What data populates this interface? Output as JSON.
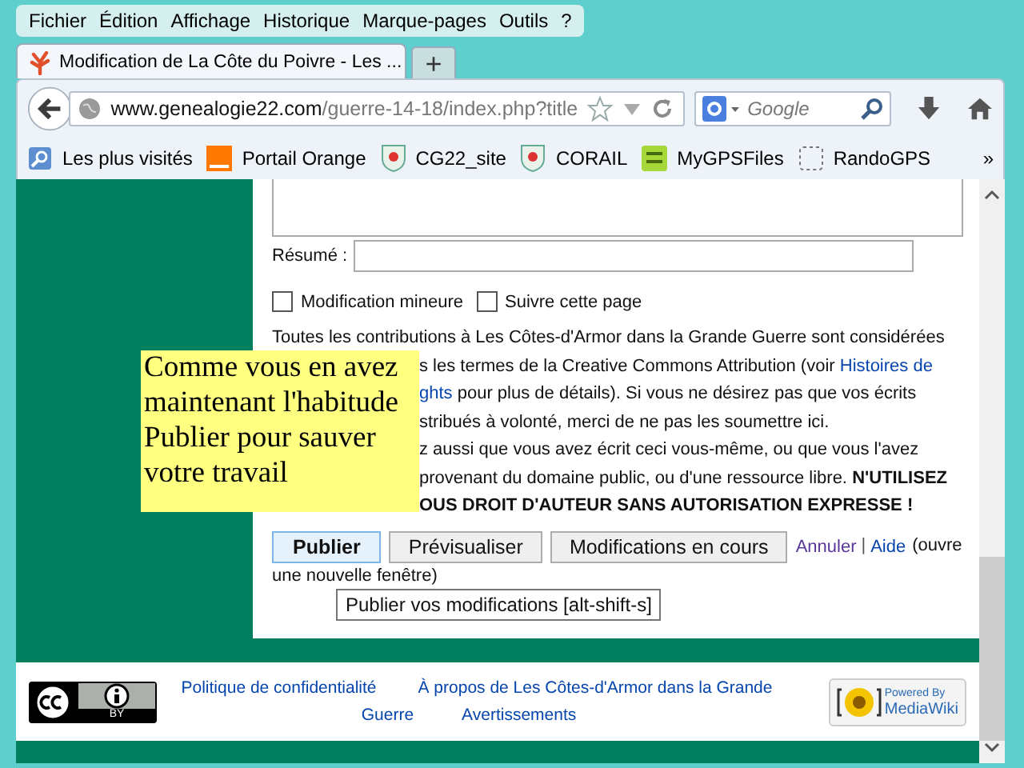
{
  "menu": [
    {
      "label": "Fichier"
    },
    {
      "label": "Édition"
    },
    {
      "label": "Affichage"
    },
    {
      "label": "Historique"
    },
    {
      "label": "Marque-pages"
    },
    {
      "label": "Outils"
    },
    {
      "label": "?"
    }
  ],
  "tabs": [
    {
      "title": "Modification de La Côte du Poivre - Les ...",
      "selected": true
    }
  ],
  "new_tab": "+",
  "address": {
    "domain": "www.genealogie22.com",
    "path": "/guerre-14-18/index.php?title"
  },
  "search": {
    "placeholder": "Google"
  },
  "bookmarks": [
    {
      "label": "Les plus visités",
      "kind": "history"
    },
    {
      "label": "Portail Orange",
      "kind": "orange"
    },
    {
      "label": "CG22_site",
      "kind": "crest"
    },
    {
      "label": "CORAIL",
      "kind": "crest"
    },
    {
      "label": "MyGPSFiles",
      "kind": "gps"
    },
    {
      "label": "RandoGPS",
      "kind": "blank"
    }
  ],
  "bookmarks_more": "»",
  "form": {
    "summary_label": "Résumé :",
    "checkboxes": [
      {
        "label": "Modification mineure",
        "checked": false
      },
      {
        "label": "Suivre cette page",
        "checked": false
      }
    ],
    "notice": [
      [
        {
          "kind": "text",
          "text": "Toutes les contributions à Les Côtes-d'Armor dans la Grande Guerre sont considérées"
        }
      ],
      [
        {
          "kind": "text",
          "text": "s les termes de la Creative Commons Attribution (voir "
        },
        {
          "kind": "link",
          "text": "Histoires de"
        }
      ],
      [
        {
          "kind": "link",
          "text": "ghts"
        },
        {
          "kind": "text",
          "text": " pour plus de détails). Si vous ne désirez pas que vos écrits"
        }
      ],
      [
        {
          "kind": "text",
          "text": "stribués à volonté, merci de ne pas les soumettre ici."
        }
      ],
      [
        {
          "kind": "text",
          "text": "z aussi que vous avez écrit ceci vous-même, ou que vous l'avez"
        }
      ],
      [
        {
          "kind": "text",
          "text": "provenant du domaine public, ou d'une ressource libre. "
        },
        {
          "kind": "bold",
          "text": "N'UTILISEZ"
        }
      ],
      [
        {
          "kind": "bold",
          "text": "OUS DROIT D'AUTEUR SANS AUTORISATION EXPRESSE !"
        }
      ]
    ],
    "buttons": [
      {
        "label": "Publier",
        "primary": true
      },
      {
        "label": "Prévisualiser",
        "primary": false
      },
      {
        "label": "Modifications en cours",
        "primary": false
      }
    ],
    "links": [
      {
        "label": "Annuler",
        "visited": true
      },
      {
        "label": "Aide",
        "visited": false
      }
    ],
    "separator": "|",
    "after_text": [
      "(ouvre",
      "une nouvelle fenêtre)"
    ],
    "tooltip": "Publier vos modifications [alt-shift-s]"
  },
  "sticky_note": "Comme vous en avez\nmaintenant l'habitude\nPublier pour sauver\nvotre travail",
  "footer": {
    "license_badge": "BY",
    "links": [
      [
        "Politique de confidentialité",
        "À propos de Les Côtes-d'Armor dans la Grande"
      ],
      [
        "Guerre",
        "Avertissements"
      ]
    ],
    "powered_top": "Powered By",
    "powered_name": "MediaWiki"
  }
}
